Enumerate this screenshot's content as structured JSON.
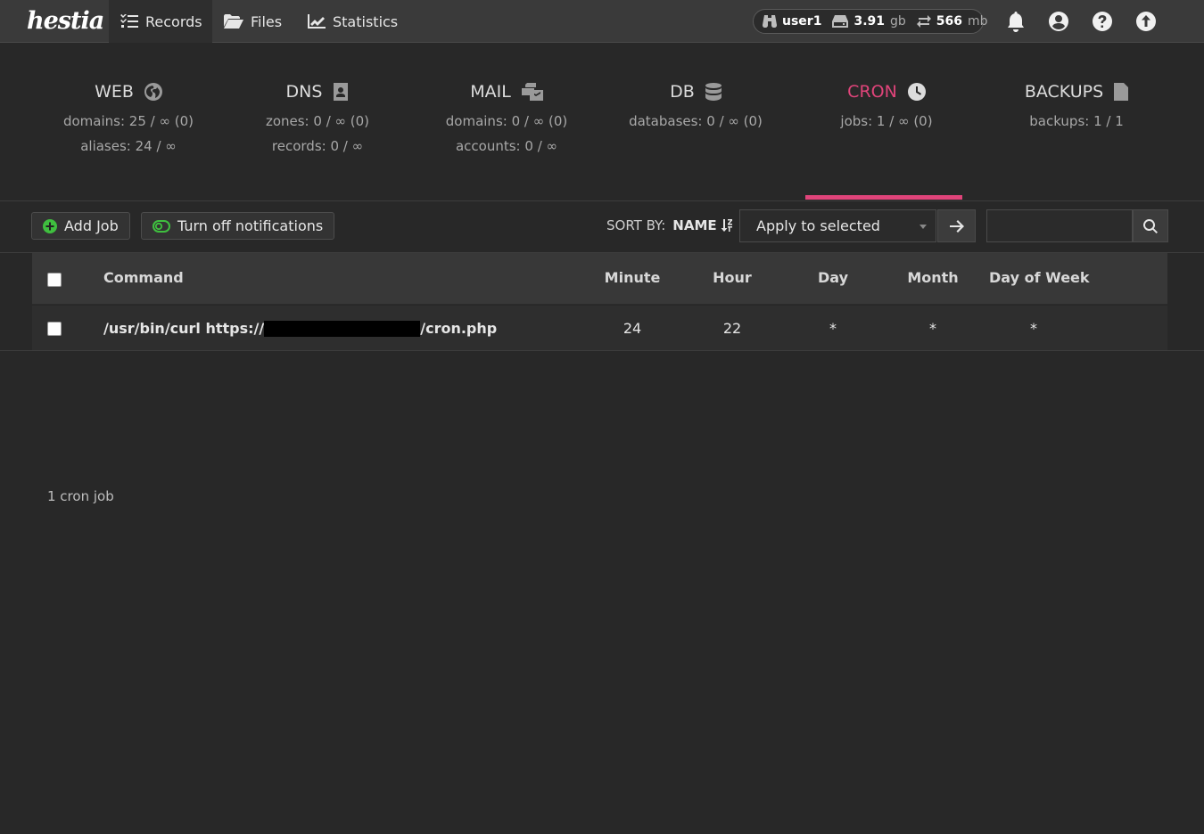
{
  "topbar": {
    "logo": "hestia",
    "nav": [
      {
        "label": "Records",
        "icon": "list-check-icon"
      },
      {
        "label": "Files",
        "icon": "folder-open-icon"
      },
      {
        "label": "Statistics",
        "icon": "chart-line-icon"
      }
    ],
    "user": {
      "name": "user1",
      "disk_value": "3.91",
      "disk_unit": "gb",
      "bandwidth_value": "566",
      "bandwidth_unit": "mb"
    }
  },
  "stats": [
    {
      "title": "WEB",
      "icon": "globe-icon",
      "lines": [
        "domains: 25 / ∞ (0)",
        "aliases: 24 / ∞"
      ]
    },
    {
      "title": "DNS",
      "icon": "address-book-icon",
      "lines": [
        "zones: 0 / ∞ (0)",
        "records: 0 / ∞"
      ]
    },
    {
      "title": "MAIL",
      "icon": "mail-bulk-icon",
      "lines": [
        "domains: 0 / ∞ (0)",
        "accounts: 0 / ∞"
      ]
    },
    {
      "title": "DB",
      "icon": "database-icon",
      "lines": [
        "databases: 0 / ∞ (0)"
      ]
    },
    {
      "title": "CRON",
      "icon": "clock-icon",
      "lines": [
        "jobs: 1 / ∞ (0)"
      ],
      "active": true
    },
    {
      "title": "BACKUPS",
      "icon": "file-archive-icon",
      "lines": [
        "backups: 1 / 1"
      ]
    }
  ],
  "toolbar": {
    "add_job": "Add Job",
    "notifications": "Turn off notifications",
    "sort_label": "SORT BY:",
    "sort_value": "NAME",
    "bulk_select": "Apply to selected",
    "search_placeholder": ""
  },
  "table": {
    "headers": {
      "command": "Command",
      "minute": "Minute",
      "hour": "Hour",
      "day": "Day",
      "month": "Month",
      "dow": "Day of Week"
    },
    "rows": [
      {
        "command_prefix": "/usr/bin/curl https://",
        "command_suffix": "/cron.php",
        "minute": "24",
        "hour": "22",
        "day": "*",
        "month": "*",
        "dow": "*"
      }
    ]
  },
  "footer": "1 cron job",
  "colors": {
    "accent": "#e0447a",
    "background": "#282828",
    "topbar": "#3a3a3a",
    "success_green": "#3fbf3f"
  }
}
